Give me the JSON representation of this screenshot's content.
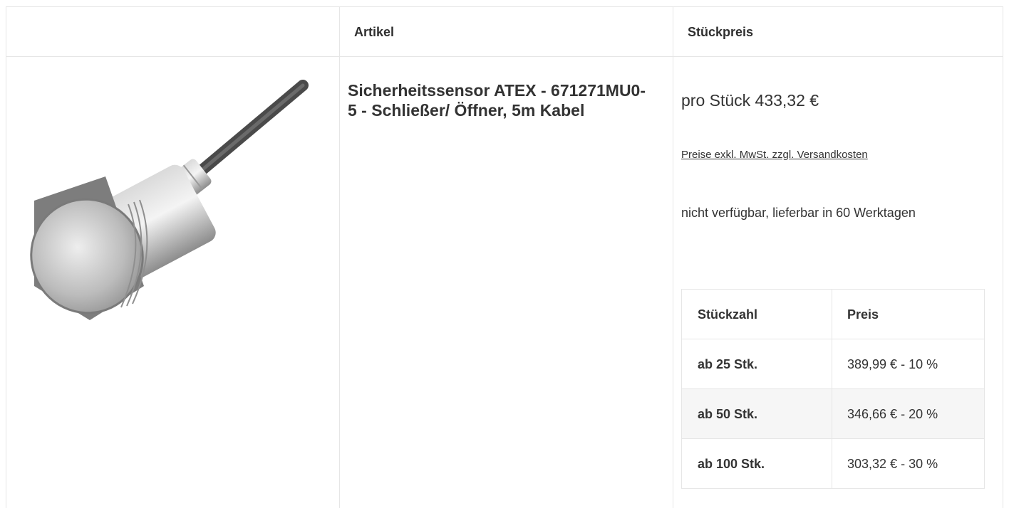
{
  "table": {
    "headers": {
      "image": "",
      "article": "Artikel",
      "unit_price": "Stückpreis"
    }
  },
  "product": {
    "image_alt": "Sicherheitssensor ATEX product photo",
    "title": "Sicherheitssensor ATEX - 671271MU0-5 - Schließer/ Öffner, 5m Kabel",
    "unit_price": "pro Stück 433,32 €",
    "price_note": "Preise exkl. MwSt. zzgl. Versandkosten",
    "availability": "nicht verfügbar, lieferbar in 60 Werktagen"
  },
  "tiers": {
    "headers": {
      "quantity": "Stückzahl",
      "price": "Preis"
    },
    "rows": [
      {
        "quantity": "ab 25 Stk.",
        "price": "389,99 € - 10 %"
      },
      {
        "quantity": "ab 50 Stk.",
        "price": "346,66 € - 20 %"
      },
      {
        "quantity": "ab 100 Stk.",
        "price": "303,32 € - 30 %"
      }
    ]
  },
  "colors": {
    "border": "#e6e6e6",
    "text": "#333333",
    "alt_row": "#f6f6f6"
  }
}
